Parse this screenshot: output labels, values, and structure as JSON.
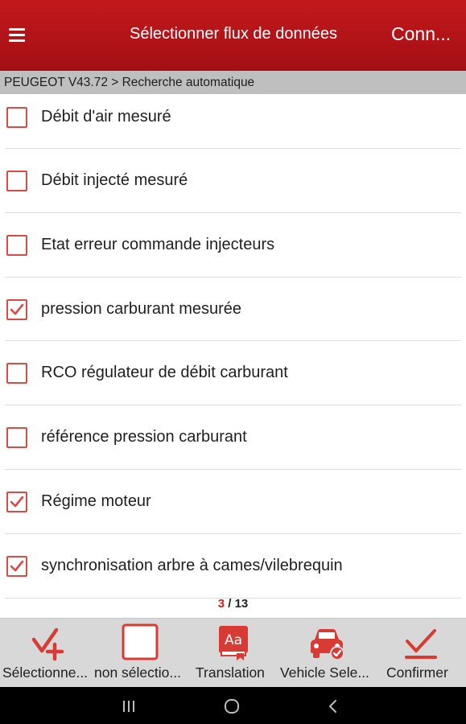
{
  "header": {
    "title": "Sélectionner flux de données",
    "action_label": "Conn..."
  },
  "breadcrumb": "PEUGEOT V43.72 > Recherche automatique",
  "items": [
    {
      "label": "Débit d'air mesuré",
      "checked": false
    },
    {
      "label": "Débit injecté mesuré",
      "checked": false
    },
    {
      "label": "Etat erreur commande injecteurs",
      "checked": false
    },
    {
      "label": "pression carburant mesurée",
      "checked": true
    },
    {
      "label": "RCO régulateur de débit carburant",
      "checked": false
    },
    {
      "label": "référence pression carburant",
      "checked": false
    },
    {
      "label": "Régime moteur",
      "checked": true
    },
    {
      "label": "synchronisation arbre à cames/vilebrequin",
      "checked": true
    }
  ],
  "pager": {
    "current": "3",
    "separator": "/",
    "total": "13"
  },
  "toolbar": {
    "select_all": "Sélectionne...",
    "deselect": "non sélectio...",
    "translation": "Translation",
    "vehicle": "Vehicle Sele...",
    "confirm": "Confirmer",
    "translation_icon_text": "Aa"
  },
  "colors": {
    "accent": "#c3191d",
    "checkbox": "#d94b46",
    "toolbar_bg": "#d8d8d8",
    "icon_red": "#d83a34"
  },
  "icons": {
    "menu": "hamburger-menu-icon",
    "select_all": "check-plus-icon",
    "deselect": "empty-square-icon",
    "translation": "translate-book-icon",
    "vehicle": "car-check-icon",
    "confirm": "check-underline-icon"
  }
}
